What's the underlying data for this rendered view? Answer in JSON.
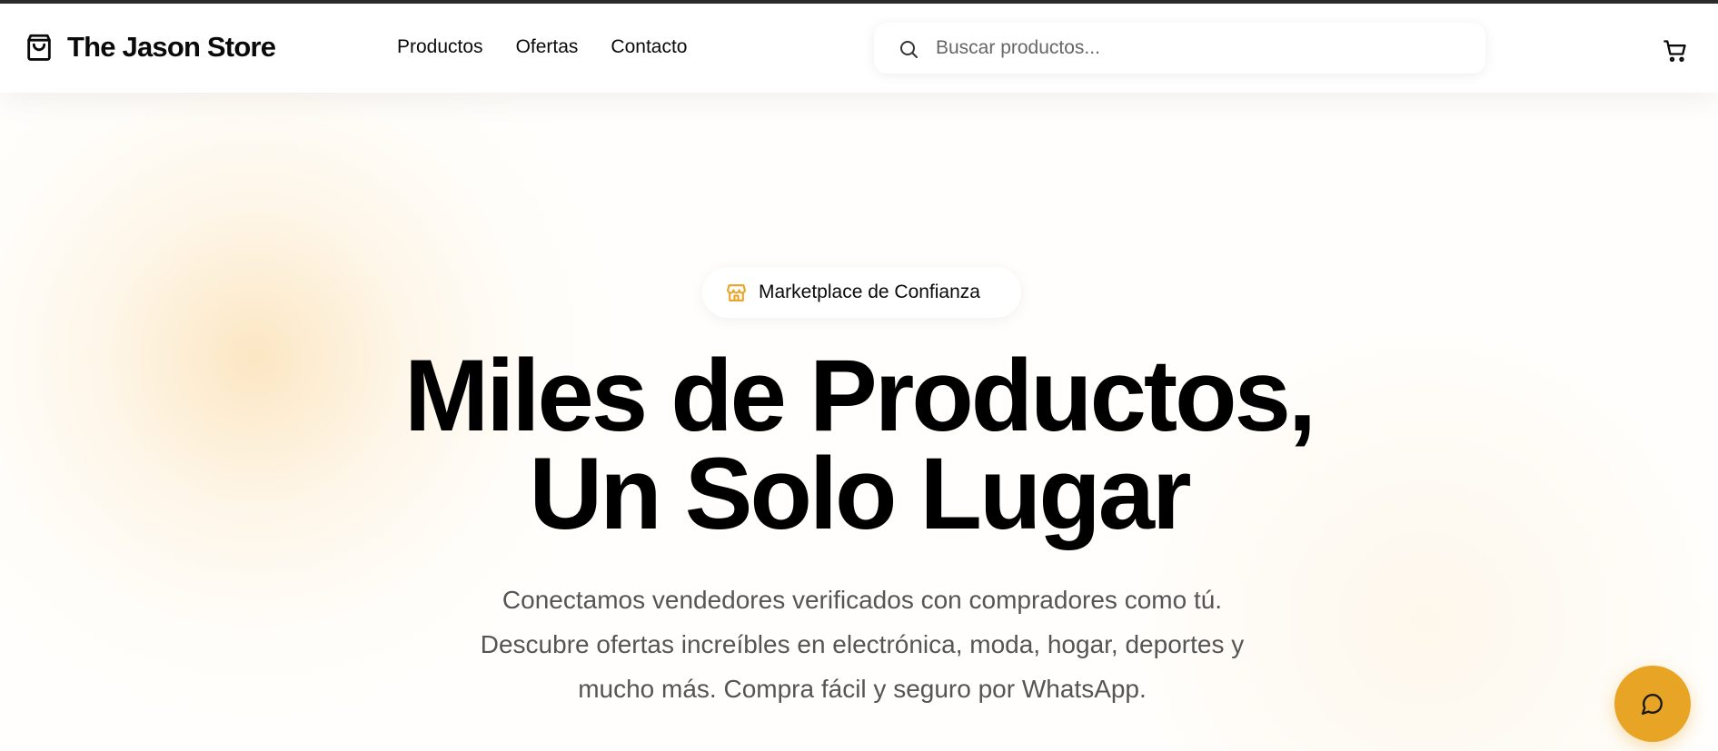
{
  "header": {
    "store_name": "The Jason Store",
    "nav": [
      "Productos",
      "Ofertas",
      "Contacto"
    ],
    "search_placeholder": "Buscar productos..."
  },
  "hero": {
    "badge": "Marketplace de Confianza",
    "title_line1": "Miles de Productos,",
    "title_line2": "Un Solo Lugar",
    "subtitle_line1": "Conectamos vendedores verificados con compradores como tú.",
    "subtitle_line2": "Descubre ofertas increíbles en electrónica, moda, hogar, deportes y",
    "subtitle_line3": "mucho más. Compra fácil y seguro por WhatsApp."
  },
  "icons": {
    "logo": "shopping-bag-icon",
    "search": "search-icon",
    "cart": "shopping-cart-icon",
    "badge": "store-icon",
    "chat": "message-circle-icon"
  },
  "colors": {
    "accent": "#e8a425",
    "text": "#0a0a0a",
    "muted": "#555555",
    "background": "#ffffff"
  }
}
